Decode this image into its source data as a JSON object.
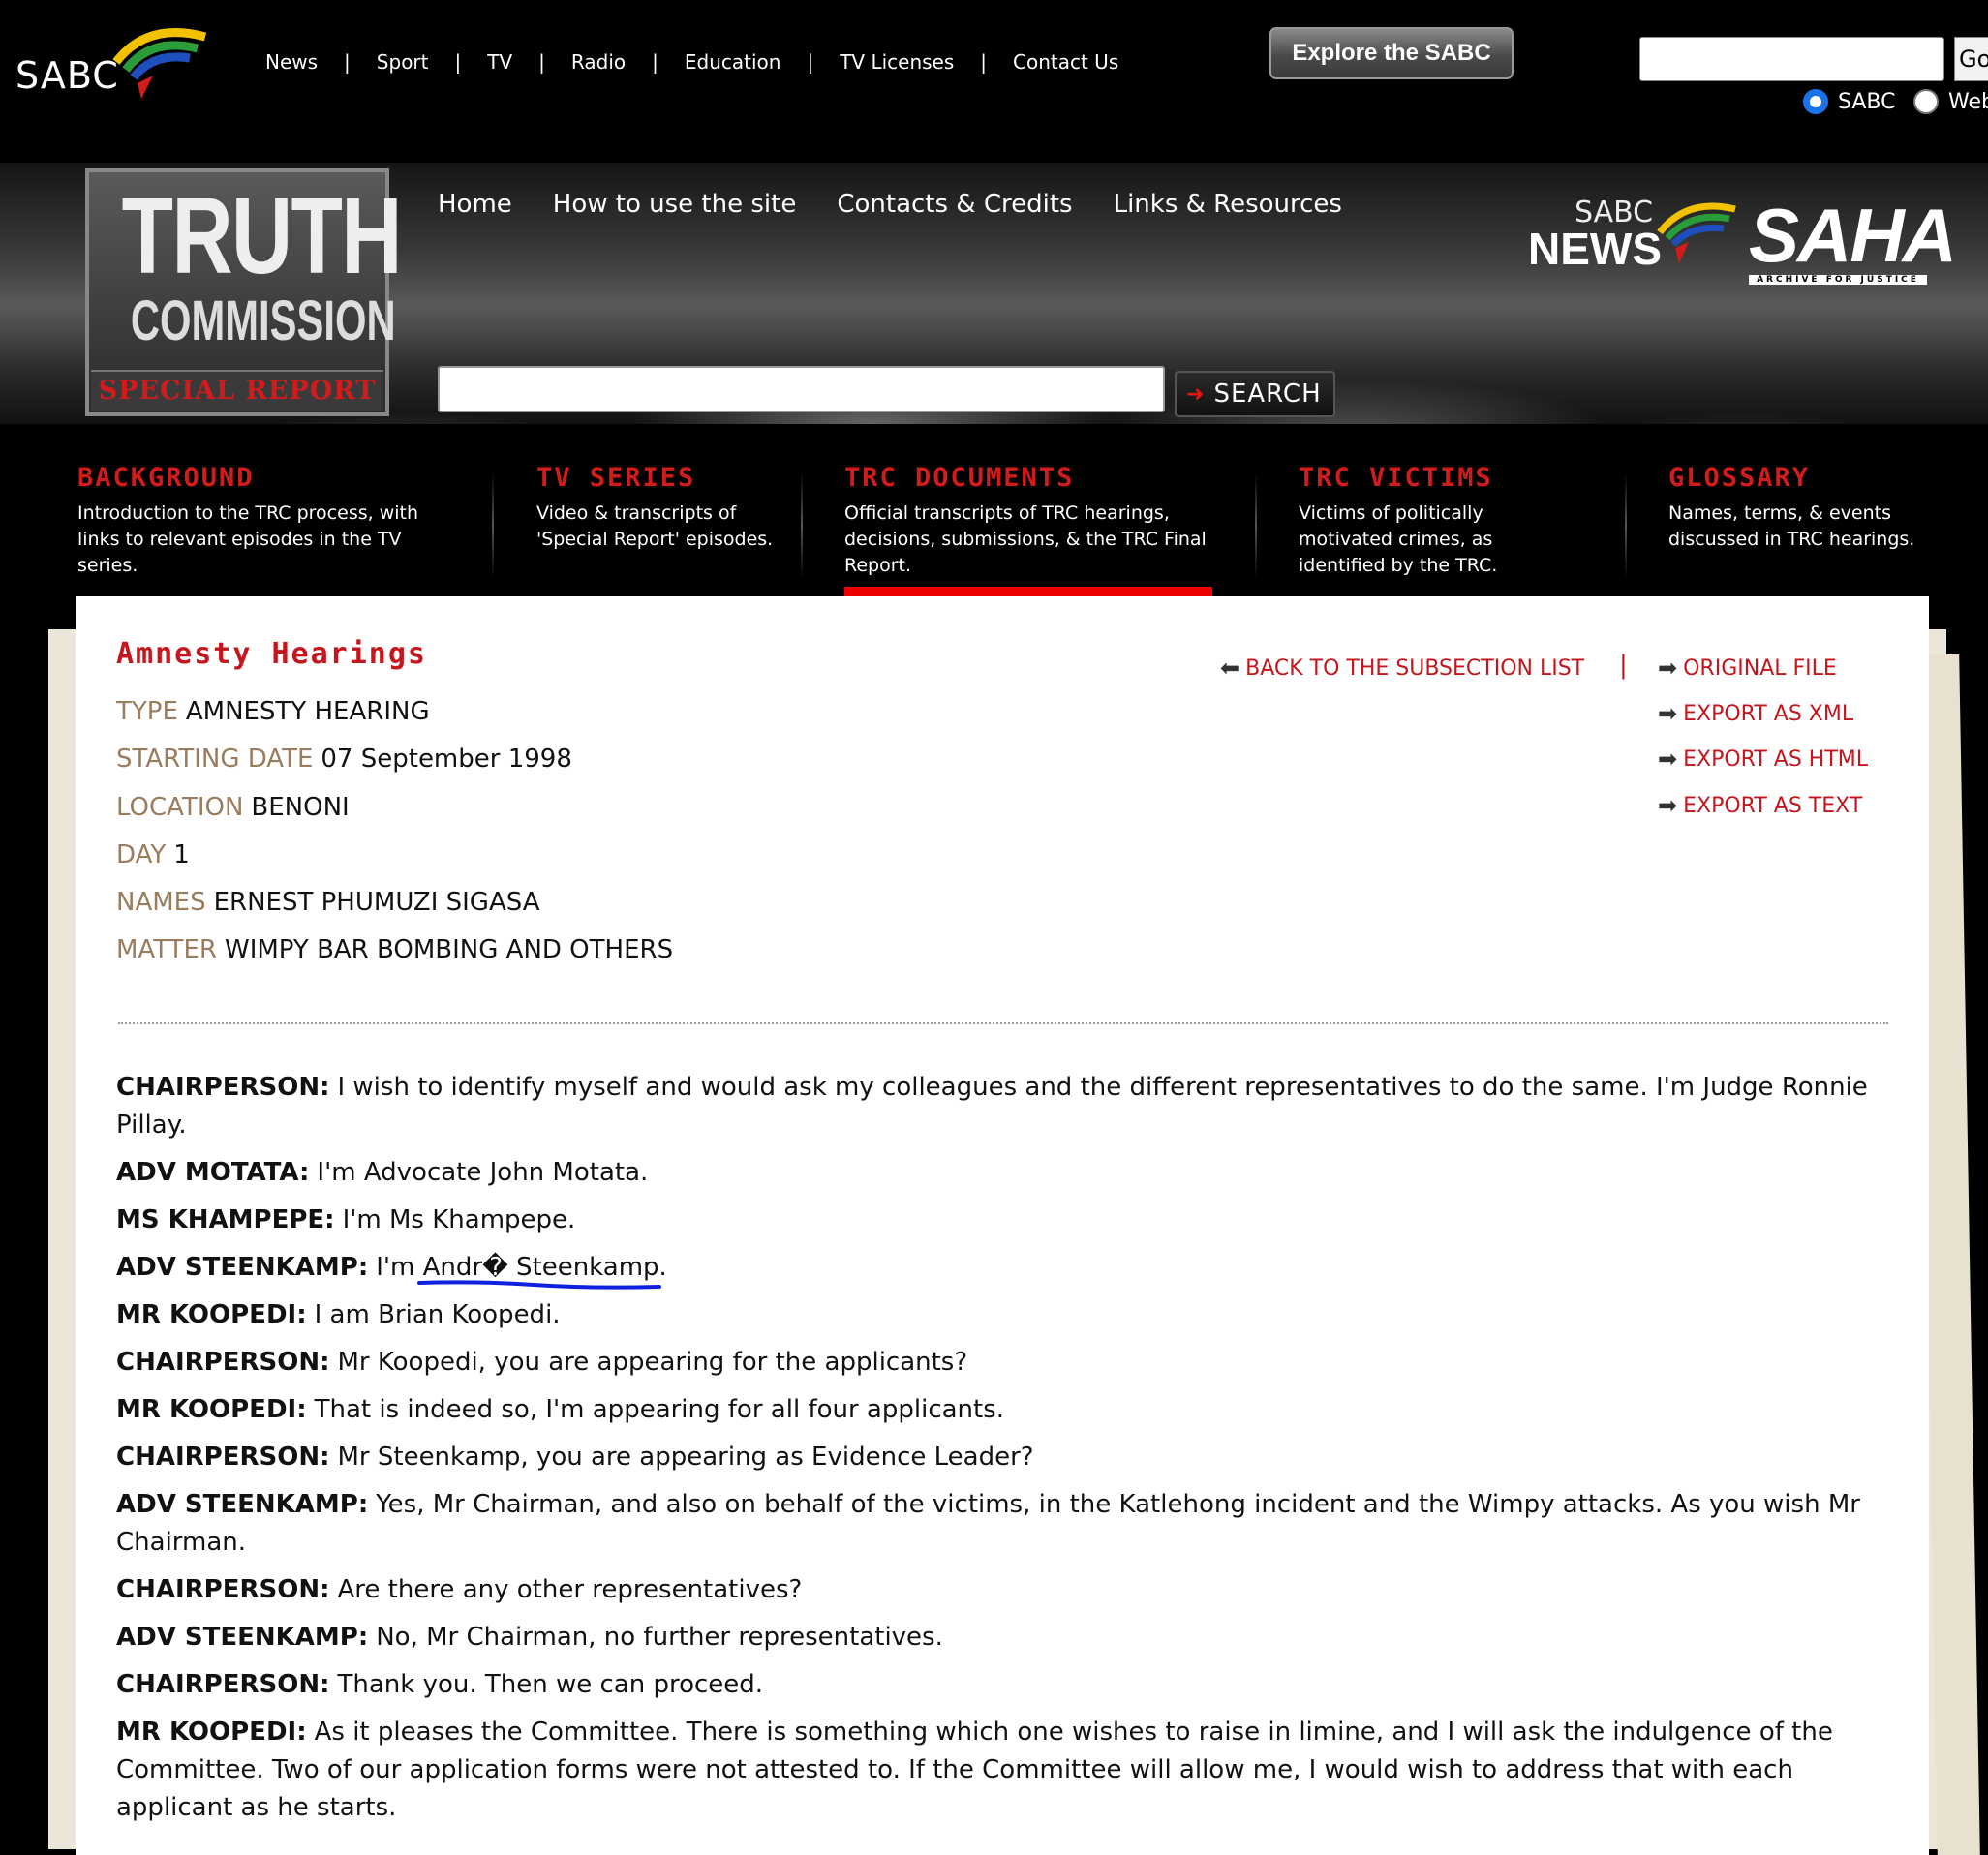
{
  "topbar": {
    "logo_text": "SABC",
    "nav": [
      "News",
      "Sport",
      "TV",
      "Radio",
      "Education",
      "TV Licenses",
      "Contact Us"
    ],
    "separator": "|",
    "explore_label": "Explore the SABC",
    "search_value": "",
    "go_label": "Go",
    "radio_options": [
      {
        "label": "SABC",
        "selected": true
      },
      {
        "label": "Web",
        "selected": false
      }
    ]
  },
  "header": {
    "logo": {
      "line1": "TRUTH",
      "line2": "COMMISSION",
      "line3": "SPECIAL REPORT"
    },
    "nav": [
      "Home",
      "How to use the site",
      "Contacts & Credits",
      "Links & Resources"
    ],
    "search_value": "",
    "search_label": "SEARCH",
    "partner_sabc_small": "SABC",
    "partner_news": "NEWS",
    "partner_saha": "SAHA",
    "partner_saha_tag": "ARCHIVE FOR JUSTICE"
  },
  "sections": [
    {
      "title": "BACKGROUND",
      "desc": "Introduction to the TRC process, with links to relevant episodes in the TV series.",
      "active": false
    },
    {
      "title": "TV SERIES",
      "desc": "Video & transcripts of 'Special Report' episodes.",
      "active": false
    },
    {
      "title": "TRC DOCUMENTS",
      "desc": "Official transcripts of TRC hearings, decisions, submissions, & the TRC Final Report.",
      "active": true
    },
    {
      "title": "TRC VICTIMS",
      "desc": "Victims of politically motivated crimes, as identified by the TRC.",
      "active": false
    },
    {
      "title": "GLOSSARY",
      "desc": "Names, terms, & events discussed in TRC hearings.",
      "active": false
    }
  ],
  "document": {
    "title": "Amnesty Hearings",
    "meta": [
      {
        "key": "TYPE",
        "value": "AMNESTY HEARING"
      },
      {
        "key": "STARTING DATE",
        "value": "07 September 1998"
      },
      {
        "key": "LOCATION",
        "value": "BENONI"
      },
      {
        "key": "DAY",
        "value": "1"
      },
      {
        "key": "NAMES",
        "value": "ERNEST PHUMUZI SIGASA"
      },
      {
        "key": "MATTER",
        "value": "WIMPY BAR BOMBING AND OTHERS"
      }
    ],
    "back_link": "BACK TO THE SUBSECTION LIST",
    "link_separator": "|",
    "export_links": [
      "ORIGINAL FILE",
      "EXPORT AS XML",
      "EXPORT AS HTML",
      "EXPORT AS TEXT"
    ],
    "transcript": [
      {
        "speaker": "CHAIRPERSON:",
        "text": "I wish to identify myself and would ask my colleagues and the different representatives to do the same. I'm Judge Ronnie Pillay."
      },
      {
        "speaker": "ADV MOTATA:",
        "text": "I'm Advocate John Motata."
      },
      {
        "speaker": "MS KHAMPEPE:",
        "text": "I'm Ms Khampepe."
      },
      {
        "speaker": "ADV STEENKAMP:",
        "text": "I'm Andr� Steenkamp."
      },
      {
        "speaker": "MR KOOPEDI:",
        "text": "I am Brian Koopedi."
      },
      {
        "speaker": "CHAIRPERSON:",
        "text": "Mr Koopedi, you are appearing for the applicants?"
      },
      {
        "speaker": "MR KOOPEDI:",
        "text": "That is indeed so, I'm appearing for all four applicants."
      },
      {
        "speaker": "CHAIRPERSON:",
        "text": "Mr Steenkamp, you are appearing as Evidence Leader?"
      },
      {
        "speaker": "ADV STEENKAMP:",
        "text": "Yes, Mr Chairman, and also on behalf of the victims, in the Katlehong incident and the Wimpy attacks. As you wish Mr Chairman."
      },
      {
        "speaker": "CHAIRPERSON:",
        "text": "Are there any other representatives?"
      },
      {
        "speaker": "ADV STEENKAMP:",
        "text": "No, Mr Chairman, no further representatives."
      },
      {
        "speaker": "CHAIRPERSON:",
        "text": "Thank you. Then we can proceed."
      },
      {
        "speaker": "MR KOOPEDI:",
        "text": "As it pleases the Committee. There is something which one wishes to raise in limine, and I will ask the indulgence of the Committee. Two of our application forms were not attested to. If the Committee will allow me, I would wish to address that with each applicant as he starts."
      }
    ]
  },
  "colors": {
    "accent_red": "#c4161c",
    "meta_key": "#9a7c5e",
    "annotation_blue": "#1020e0"
  },
  "icons": {
    "link_arrow": "arrow-right-icon",
    "back_arrow": "arrow-left-icon"
  }
}
